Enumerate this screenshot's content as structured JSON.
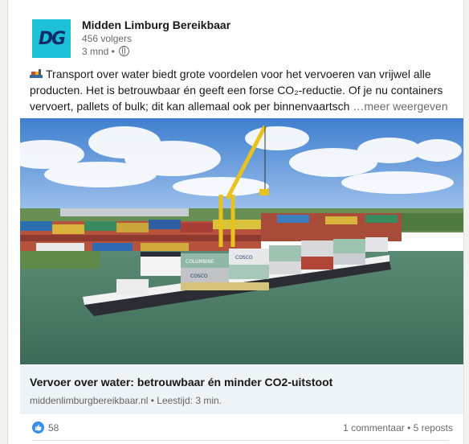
{
  "author": {
    "logo_text": "DG",
    "name": "Midden Limburg Bereikbaar",
    "followers": "456 volgers",
    "time": "3 mnd •"
  },
  "post": {
    "line1": "Transport over water biedt grote voordelen voor het vervoeren van vrijwel alle",
    "line2": "producten. Het is betrouwbaar én geeft een forse CO₂-reductie. Of je nu containers",
    "line3": "vervoert, pallets of bulk; dit kan allemaal ook per binnenvaartsch",
    "more": "…meer weergeven"
  },
  "image_labels": {
    "container1": "COLUMBINE",
    "container2": "COSCO",
    "container3": "COSCO"
  },
  "link_preview": {
    "title": "Vervoer over water: betrouwbaar én minder CO2-uitstoot",
    "meta": "middenlimburgbereikbaar.nl • Leestijd: 3 min."
  },
  "social": {
    "likes": "58",
    "comments_reposts": "1 commentaar • 5 reposts"
  },
  "colors": {
    "logo_bg": "#1ec0d8",
    "logo_fg": "#0b2c6f",
    "like_blue": "#378fe9",
    "link_preview_bg": "#eef3f8"
  },
  "icons": [
    "ship-emoji-icon",
    "globe-icon",
    "like-reaction-icon"
  ]
}
